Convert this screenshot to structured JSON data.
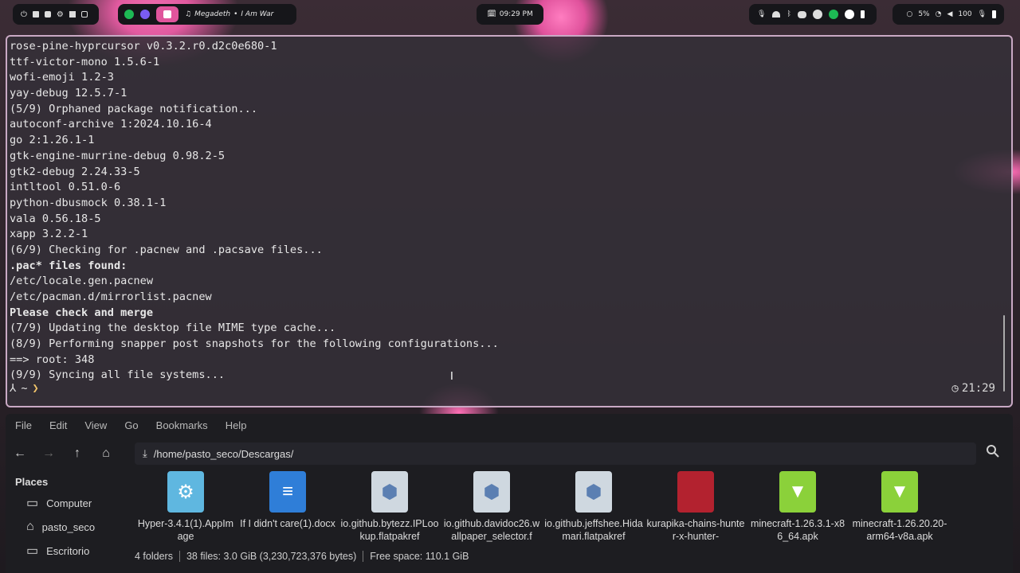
{
  "topbar": {
    "now_playing": {
      "artist": "Megadeth",
      "separator": "•",
      "title": "I Am War"
    },
    "clock": "09:29 PM",
    "battery_left_label": "5%",
    "battery_right_label": "100",
    "icons_left": [
      "power-icon",
      "terminal-icon",
      "files-icon",
      "settings-icon",
      "grid-icon",
      "window-icon"
    ],
    "icons_right": [
      "mic-icon",
      "wifi-icon",
      "bluetooth-icon",
      "discord-icon",
      "steam-icon",
      "spotify-icon",
      "chat-icon",
      "battery-icon"
    ]
  },
  "terminal": {
    "lines": [
      {
        "text": "rose-pine-hyprcursor v0.3.2.r0.d2c0e680-1",
        "bold": false
      },
      {
        "text": "ttf-victor-mono 1.5.6-1",
        "bold": false
      },
      {
        "text": "wofi-emoji 1.2-3",
        "bold": false
      },
      {
        "text": "yay-debug 12.5.7-1",
        "bold": false
      },
      {
        "text": "(5/9) Orphaned package notification...",
        "bold": false
      },
      {
        "text": "autoconf-archive 1:2024.10.16-4",
        "bold": false
      },
      {
        "text": "go 2:1.26.1-1",
        "bold": false
      },
      {
        "text": "gtk-engine-murrine-debug 0.98.2-5",
        "bold": false
      },
      {
        "text": "gtk2-debug 2.24.33-5",
        "bold": false
      },
      {
        "text": "intltool 0.51.0-6",
        "bold": false
      },
      {
        "text": "python-dbusmock 0.38.1-1",
        "bold": false
      },
      {
        "text": "vala 0.56.18-5",
        "bold": false
      },
      {
        "text": "xapp 3.2.2-1",
        "bold": false
      },
      {
        "text": "(6/9) Checking for .pacnew and .pacsave files...",
        "bold": false
      },
      {
        "text": ".pac* files found:",
        "bold": true
      },
      {
        "text": "/etc/locale.gen.pacnew",
        "bold": false
      },
      {
        "text": "/etc/pacman.d/mirrorlist.pacnew",
        "bold": false
      },
      {
        "text": "Please check and merge",
        "bold": true
      },
      {
        "text": "(7/9) Updating the desktop file MIME type cache...",
        "bold": false
      },
      {
        "text": "(8/9) Performing snapper post snapshots for the following configurations...",
        "bold": false
      },
      {
        "text": "==> root: 348",
        "bold": false
      },
      {
        "text": "(9/9) Syncing all file systems...",
        "bold": false
      }
    ],
    "prompt_symbol": "⅄",
    "prompt_dir": "~",
    "prompt_chevron": "❯",
    "right_clock": "21:29"
  },
  "filemanager": {
    "menu": [
      "File",
      "Edit",
      "View",
      "Go",
      "Bookmarks",
      "Help"
    ],
    "path": "/home/pasto_seco/Descargas/",
    "places_title": "Places",
    "places": [
      {
        "label": "Computer",
        "icon": "computer-icon"
      },
      {
        "label": "pasto_seco",
        "icon": "home-icon"
      },
      {
        "label": "Escritorio",
        "icon": "desktop-icon"
      }
    ],
    "files": [
      {
        "name": "Hyper-3.4.1(1).AppImage",
        "kind": "appimage",
        "color": "#5fb7e0"
      },
      {
        "name": "If I didn't care(1).docx",
        "kind": "docx",
        "color": "#2f7ed8"
      },
      {
        "name": "io.github.bytezz.IPLookup.flatpakref",
        "kind": "flatpak",
        "color": "#cfd8e0"
      },
      {
        "name": "io.github.davidoc26.wallpaper_selector.f",
        "kind": "flatpak",
        "color": "#cfd8e0"
      },
      {
        "name": "io.github.jeffshee.Hidamari.flatpakref",
        "kind": "flatpak",
        "color": "#cfd8e0"
      },
      {
        "name": "kurapika-chains-hunter-x-hunter-",
        "kind": "image",
        "color": "#b3222f"
      },
      {
        "name": "minecraft-1.26.3.1-x86_64.apk",
        "kind": "apk",
        "color": "#8bd13a"
      },
      {
        "name": "minecraft-1.26.20.20-arm64-v8a.apk",
        "kind": "apk",
        "color": "#8bd13a"
      }
    ],
    "status": {
      "folders": "4 folders",
      "files": "38 files: 3.0 GiB (3,230,723,376 bytes)",
      "free": "Free space: 110.1 GiB"
    }
  }
}
